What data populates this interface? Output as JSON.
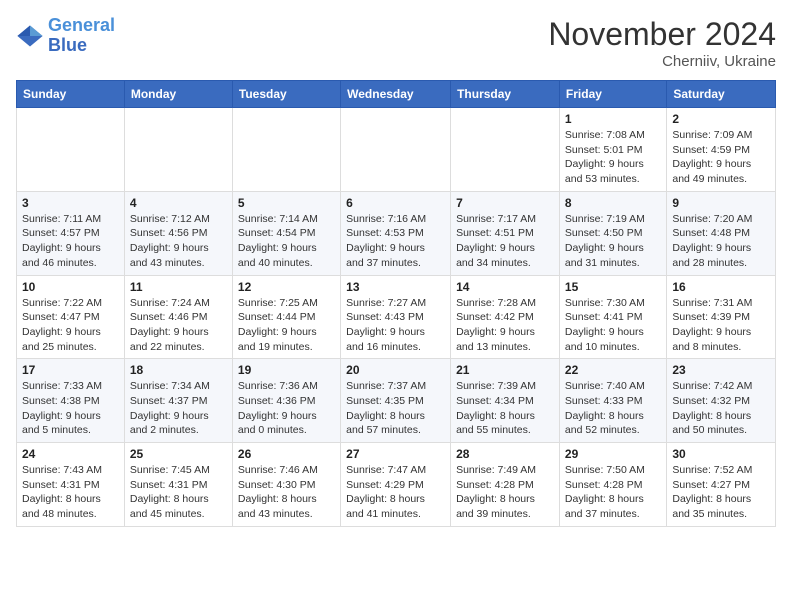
{
  "header": {
    "logo_line1": "General",
    "logo_line2": "Blue",
    "month": "November 2024",
    "location": "Cherniiv, Ukraine"
  },
  "weekdays": [
    "Sunday",
    "Monday",
    "Tuesday",
    "Wednesday",
    "Thursday",
    "Friday",
    "Saturday"
  ],
  "weeks": [
    [
      {
        "day": "",
        "info": ""
      },
      {
        "day": "",
        "info": ""
      },
      {
        "day": "",
        "info": ""
      },
      {
        "day": "",
        "info": ""
      },
      {
        "day": "",
        "info": ""
      },
      {
        "day": "1",
        "info": "Sunrise: 7:08 AM\nSunset: 5:01 PM\nDaylight: 9 hours\nand 53 minutes."
      },
      {
        "day": "2",
        "info": "Sunrise: 7:09 AM\nSunset: 4:59 PM\nDaylight: 9 hours\nand 49 minutes."
      }
    ],
    [
      {
        "day": "3",
        "info": "Sunrise: 7:11 AM\nSunset: 4:57 PM\nDaylight: 9 hours\nand 46 minutes."
      },
      {
        "day": "4",
        "info": "Sunrise: 7:12 AM\nSunset: 4:56 PM\nDaylight: 9 hours\nand 43 minutes."
      },
      {
        "day": "5",
        "info": "Sunrise: 7:14 AM\nSunset: 4:54 PM\nDaylight: 9 hours\nand 40 minutes."
      },
      {
        "day": "6",
        "info": "Sunrise: 7:16 AM\nSunset: 4:53 PM\nDaylight: 9 hours\nand 37 minutes."
      },
      {
        "day": "7",
        "info": "Sunrise: 7:17 AM\nSunset: 4:51 PM\nDaylight: 9 hours\nand 34 minutes."
      },
      {
        "day": "8",
        "info": "Sunrise: 7:19 AM\nSunset: 4:50 PM\nDaylight: 9 hours\nand 31 minutes."
      },
      {
        "day": "9",
        "info": "Sunrise: 7:20 AM\nSunset: 4:48 PM\nDaylight: 9 hours\nand 28 minutes."
      }
    ],
    [
      {
        "day": "10",
        "info": "Sunrise: 7:22 AM\nSunset: 4:47 PM\nDaylight: 9 hours\nand 25 minutes."
      },
      {
        "day": "11",
        "info": "Sunrise: 7:24 AM\nSunset: 4:46 PM\nDaylight: 9 hours\nand 22 minutes."
      },
      {
        "day": "12",
        "info": "Sunrise: 7:25 AM\nSunset: 4:44 PM\nDaylight: 9 hours\nand 19 minutes."
      },
      {
        "day": "13",
        "info": "Sunrise: 7:27 AM\nSunset: 4:43 PM\nDaylight: 9 hours\nand 16 minutes."
      },
      {
        "day": "14",
        "info": "Sunrise: 7:28 AM\nSunset: 4:42 PM\nDaylight: 9 hours\nand 13 minutes."
      },
      {
        "day": "15",
        "info": "Sunrise: 7:30 AM\nSunset: 4:41 PM\nDaylight: 9 hours\nand 10 minutes."
      },
      {
        "day": "16",
        "info": "Sunrise: 7:31 AM\nSunset: 4:39 PM\nDaylight: 9 hours\nand 8 minutes."
      }
    ],
    [
      {
        "day": "17",
        "info": "Sunrise: 7:33 AM\nSunset: 4:38 PM\nDaylight: 9 hours\nand 5 minutes."
      },
      {
        "day": "18",
        "info": "Sunrise: 7:34 AM\nSunset: 4:37 PM\nDaylight: 9 hours\nand 2 minutes."
      },
      {
        "day": "19",
        "info": "Sunrise: 7:36 AM\nSunset: 4:36 PM\nDaylight: 9 hours\nand 0 minutes."
      },
      {
        "day": "20",
        "info": "Sunrise: 7:37 AM\nSunset: 4:35 PM\nDaylight: 8 hours\nand 57 minutes."
      },
      {
        "day": "21",
        "info": "Sunrise: 7:39 AM\nSunset: 4:34 PM\nDaylight: 8 hours\nand 55 minutes."
      },
      {
        "day": "22",
        "info": "Sunrise: 7:40 AM\nSunset: 4:33 PM\nDaylight: 8 hours\nand 52 minutes."
      },
      {
        "day": "23",
        "info": "Sunrise: 7:42 AM\nSunset: 4:32 PM\nDaylight: 8 hours\nand 50 minutes."
      }
    ],
    [
      {
        "day": "24",
        "info": "Sunrise: 7:43 AM\nSunset: 4:31 PM\nDaylight: 8 hours\nand 48 minutes."
      },
      {
        "day": "25",
        "info": "Sunrise: 7:45 AM\nSunset: 4:31 PM\nDaylight: 8 hours\nand 45 minutes."
      },
      {
        "day": "26",
        "info": "Sunrise: 7:46 AM\nSunset: 4:30 PM\nDaylight: 8 hours\nand 43 minutes."
      },
      {
        "day": "27",
        "info": "Sunrise: 7:47 AM\nSunset: 4:29 PM\nDaylight: 8 hours\nand 41 minutes."
      },
      {
        "day": "28",
        "info": "Sunrise: 7:49 AM\nSunset: 4:28 PM\nDaylight: 8 hours\nand 39 minutes."
      },
      {
        "day": "29",
        "info": "Sunrise: 7:50 AM\nSunset: 4:28 PM\nDaylight: 8 hours\nand 37 minutes."
      },
      {
        "day": "30",
        "info": "Sunrise: 7:52 AM\nSunset: 4:27 PM\nDaylight: 8 hours\nand 35 minutes."
      }
    ]
  ]
}
